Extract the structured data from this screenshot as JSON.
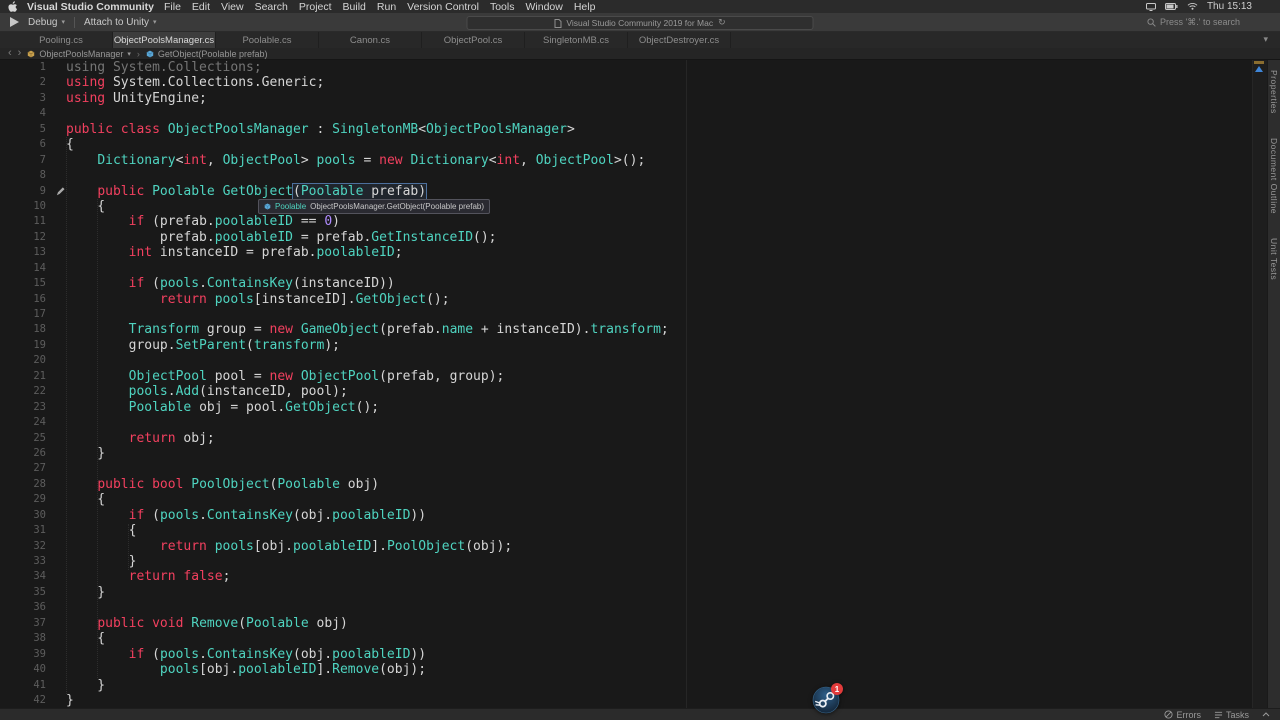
{
  "colors": {
    "fg": "#d6d6d6",
    "kw": "#f2405f",
    "ty": "#4fd4c0",
    "num": "#b08cff",
    "dim": "#757575",
    "accent_blue": "#3f86d8"
  },
  "icons": {
    "chevron_down": "▾",
    "refresh": "↻",
    "back": "‹",
    "forward": "›",
    "close_tab": "×",
    "tab_overflow": "▾"
  },
  "menubar": {
    "app": "Visual Studio Community",
    "items": [
      "File",
      "Edit",
      "View",
      "Search",
      "Project",
      "Build",
      "Run",
      "Version Control",
      "Tools",
      "Window",
      "Help"
    ],
    "time": "Thu 15:13"
  },
  "toolbar": {
    "config": "Debug",
    "target": "Attach to Unity",
    "status": "Visual Studio Community 2019 for Mac",
    "search": "Press '⌘.' to search"
  },
  "tabs": [
    {
      "label": "Pooling.cs",
      "active": false
    },
    {
      "label": "ObjectPoolsManager.cs",
      "active": true
    },
    {
      "label": "Poolable.cs",
      "active": false
    },
    {
      "label": "Canon.cs",
      "active": false
    },
    {
      "label": "ObjectPool.cs",
      "active": false
    },
    {
      "label": "SingletonMB.cs",
      "active": false
    },
    {
      "label": "ObjectDestroyer.cs",
      "active": false
    }
  ],
  "breadcrumb": {
    "item1": "ObjectPoolsManager",
    "item2": "GetObject(Poolable prefab)"
  },
  "tooltip": {
    "type": "Poolable",
    "signature": "ObjectPoolsManager.GetObject(Poolable prefab)"
  },
  "side_panel": {
    "labels": [
      "Properties",
      "Document Outline",
      "Unit Tests"
    ]
  },
  "statusbar": {
    "errors_label": "Errors",
    "tasks_label": "Tasks"
  },
  "overlay": {
    "steam_badge": "1"
  },
  "code": {
    "lines": [
      {
        "n": 1,
        "s": [
          [
            "g",
            "using System.Collections;"
          ]
        ]
      },
      {
        "n": 2,
        "s": [
          [
            "k",
            "using"
          ],
          [
            "w",
            " System.Collections.Generic;"
          ]
        ]
      },
      {
        "n": 3,
        "s": [
          [
            "k",
            "using"
          ],
          [
            "w",
            " UnityEngine;"
          ]
        ]
      },
      {
        "n": 4,
        "s": []
      },
      {
        "n": 5,
        "s": [
          [
            "k",
            "public class"
          ],
          [
            "w",
            " "
          ],
          [
            "t",
            "ObjectPoolsManager"
          ],
          [
            "w",
            " : "
          ],
          [
            "t",
            "SingletonMB"
          ],
          [
            "w",
            "<"
          ],
          [
            "t",
            "ObjectPoolsManager"
          ],
          [
            "w",
            ">"
          ]
        ]
      },
      {
        "n": 6,
        "s": [
          [
            "w",
            "{"
          ]
        ]
      },
      {
        "n": 7,
        "s": [
          [
            "w",
            "    "
          ],
          [
            "t",
            "Dictionary"
          ],
          [
            "w",
            "<"
          ],
          [
            "k",
            "int"
          ],
          [
            "w",
            ", "
          ],
          [
            "t",
            "ObjectPool"
          ],
          [
            "w",
            "> "
          ],
          [
            "t",
            "pools"
          ],
          [
            "w",
            " = "
          ],
          [
            "k",
            "new"
          ],
          [
            "w",
            " "
          ],
          [
            "t",
            "Dictionary"
          ],
          [
            "w",
            "<"
          ],
          [
            "k",
            "int"
          ],
          [
            "w",
            ", "
          ],
          [
            "t",
            "ObjectPool"
          ],
          [
            "w",
            ">();"
          ]
        ]
      },
      {
        "n": 8,
        "s": []
      },
      {
        "n": 9,
        "edit": true,
        "s": [
          [
            "w",
            "    "
          ],
          [
            "k",
            "public"
          ],
          [
            "w",
            " "
          ],
          [
            "t",
            "Poolable"
          ],
          [
            "w",
            " "
          ],
          [
            "t",
            "GetObject"
          ],
          {
            "box": [
              [
                "w",
                "("
              ],
              [
                "t",
                "Poolable"
              ],
              [
                "w",
                " prefab)"
              ]
            ]
          }
        ]
      },
      {
        "n": 10,
        "s": [
          [
            "w",
            "    {"
          ]
        ]
      },
      {
        "n": 11,
        "s": [
          [
            "w",
            "        "
          ],
          [
            "k",
            "if"
          ],
          [
            "w",
            " (prefab."
          ],
          [
            "t",
            "poolableID"
          ],
          [
            "w",
            " == "
          ],
          [
            "n",
            "0"
          ],
          [
            "w",
            ")"
          ]
        ]
      },
      {
        "n": 12,
        "s": [
          [
            "w",
            "            prefab."
          ],
          [
            "t",
            "poolableID"
          ],
          [
            "w",
            " = prefab."
          ],
          [
            "t",
            "GetInstanceID"
          ],
          [
            "w",
            "();"
          ]
        ]
      },
      {
        "n": 13,
        "s": [
          [
            "w",
            "        "
          ],
          [
            "k",
            "int"
          ],
          [
            "w",
            " instanceID = prefab."
          ],
          [
            "t",
            "poolableID"
          ],
          [
            "w",
            ";"
          ]
        ]
      },
      {
        "n": 14,
        "s": []
      },
      {
        "n": 15,
        "s": [
          [
            "w",
            "        "
          ],
          [
            "k",
            "if"
          ],
          [
            "w",
            " ("
          ],
          [
            "t",
            "pools"
          ],
          [
            "w",
            "."
          ],
          [
            "t",
            "ContainsKey"
          ],
          [
            "w",
            "(instanceID))"
          ]
        ]
      },
      {
        "n": 16,
        "s": [
          [
            "w",
            "            "
          ],
          [
            "k",
            "return"
          ],
          [
            "w",
            " "
          ],
          [
            "t",
            "pools"
          ],
          [
            "w",
            "[instanceID]."
          ],
          [
            "t",
            "GetObject"
          ],
          [
            "w",
            "();"
          ]
        ]
      },
      {
        "n": 17,
        "s": []
      },
      {
        "n": 18,
        "s": [
          [
            "w",
            "        "
          ],
          [
            "t",
            "Transform"
          ],
          [
            "w",
            " group = "
          ],
          [
            "k",
            "new"
          ],
          [
            "w",
            " "
          ],
          [
            "t",
            "GameObject"
          ],
          [
            "w",
            "(prefab."
          ],
          [
            "t",
            "name"
          ],
          [
            "w",
            " + instanceID)."
          ],
          [
            "t",
            "transform"
          ],
          [
            "w",
            ";"
          ]
        ]
      },
      {
        "n": 19,
        "s": [
          [
            "w",
            "        group."
          ],
          [
            "t",
            "SetParent"
          ],
          [
            "w",
            "("
          ],
          [
            "t",
            "transform"
          ],
          [
            "w",
            ");"
          ]
        ]
      },
      {
        "n": 20,
        "s": []
      },
      {
        "n": 21,
        "s": [
          [
            "w",
            "        "
          ],
          [
            "t",
            "ObjectPool"
          ],
          [
            "w",
            " pool = "
          ],
          [
            "k",
            "new"
          ],
          [
            "w",
            " "
          ],
          [
            "t",
            "ObjectPool"
          ],
          [
            "w",
            "(prefab, group);"
          ]
        ]
      },
      {
        "n": 22,
        "s": [
          [
            "w",
            "        "
          ],
          [
            "t",
            "pools"
          ],
          [
            "w",
            "."
          ],
          [
            "t",
            "Add"
          ],
          [
            "w",
            "(instanceID, pool);"
          ]
        ]
      },
      {
        "n": 23,
        "s": [
          [
            "w",
            "        "
          ],
          [
            "t",
            "Poolable"
          ],
          [
            "w",
            " obj = pool."
          ],
          [
            "t",
            "GetObject"
          ],
          [
            "w",
            "();"
          ]
        ]
      },
      {
        "n": 24,
        "s": []
      },
      {
        "n": 25,
        "s": [
          [
            "w",
            "        "
          ],
          [
            "k",
            "return"
          ],
          [
            "w",
            " obj;"
          ]
        ]
      },
      {
        "n": 26,
        "s": [
          [
            "w",
            "    }"
          ]
        ]
      },
      {
        "n": 27,
        "s": []
      },
      {
        "n": 28,
        "s": [
          [
            "w",
            "    "
          ],
          [
            "k",
            "public"
          ],
          [
            "w",
            " "
          ],
          [
            "k",
            "bool"
          ],
          [
            "w",
            " "
          ],
          [
            "t",
            "PoolObject"
          ],
          [
            "w",
            "("
          ],
          [
            "t",
            "Poolable"
          ],
          [
            "w",
            " obj)"
          ]
        ]
      },
      {
        "n": 29,
        "s": [
          [
            "w",
            "    {"
          ]
        ]
      },
      {
        "n": 30,
        "s": [
          [
            "w",
            "        "
          ],
          [
            "k",
            "if"
          ],
          [
            "w",
            " ("
          ],
          [
            "t",
            "pools"
          ],
          [
            "w",
            "."
          ],
          [
            "t",
            "ContainsKey"
          ],
          [
            "w",
            "(obj."
          ],
          [
            "t",
            "poolableID"
          ],
          [
            "w",
            "))"
          ]
        ]
      },
      {
        "n": 31,
        "s": [
          [
            "w",
            "        {"
          ]
        ]
      },
      {
        "n": 32,
        "s": [
          [
            "w",
            "            "
          ],
          [
            "k",
            "return"
          ],
          [
            "w",
            " "
          ],
          [
            "t",
            "pools"
          ],
          [
            "w",
            "[obj."
          ],
          [
            "t",
            "poolableID"
          ],
          [
            "w",
            "]."
          ],
          [
            "t",
            "PoolObject"
          ],
          [
            "w",
            "(obj);"
          ]
        ]
      },
      {
        "n": 33,
        "s": [
          [
            "w",
            "        }"
          ]
        ]
      },
      {
        "n": 34,
        "s": [
          [
            "w",
            "        "
          ],
          [
            "k",
            "return"
          ],
          [
            "w",
            " "
          ],
          [
            "k",
            "false"
          ],
          [
            "w",
            ";"
          ]
        ]
      },
      {
        "n": 35,
        "s": [
          [
            "w",
            "    }"
          ]
        ]
      },
      {
        "n": 36,
        "s": []
      },
      {
        "n": 37,
        "s": [
          [
            "w",
            "    "
          ],
          [
            "k",
            "public"
          ],
          [
            "w",
            " "
          ],
          [
            "k",
            "void"
          ],
          [
            "w",
            " "
          ],
          [
            "t",
            "Remove"
          ],
          [
            "w",
            "("
          ],
          [
            "t",
            "Poolable"
          ],
          [
            "w",
            " obj)"
          ]
        ]
      },
      {
        "n": 38,
        "s": [
          [
            "w",
            "    {"
          ]
        ]
      },
      {
        "n": 39,
        "s": [
          [
            "w",
            "        "
          ],
          [
            "k",
            "if"
          ],
          [
            "w",
            " ("
          ],
          [
            "t",
            "pools"
          ],
          [
            "w",
            "."
          ],
          [
            "t",
            "ContainsKey"
          ],
          [
            "w",
            "(obj."
          ],
          [
            "t",
            "poolableID"
          ],
          [
            "w",
            "))"
          ]
        ]
      },
      {
        "n": 40,
        "s": [
          [
            "w",
            "            "
          ],
          [
            "t",
            "pools"
          ],
          [
            "w",
            "[obj."
          ],
          [
            "t",
            "poolableID"
          ],
          [
            "w",
            "]."
          ],
          [
            "t",
            "Remove"
          ],
          [
            "w",
            "(obj);"
          ]
        ]
      },
      {
        "n": 41,
        "s": [
          [
            "w",
            "    }"
          ]
        ]
      },
      {
        "n": 42,
        "s": [
          [
            "w",
            "}"
          ]
        ]
      }
    ]
  }
}
